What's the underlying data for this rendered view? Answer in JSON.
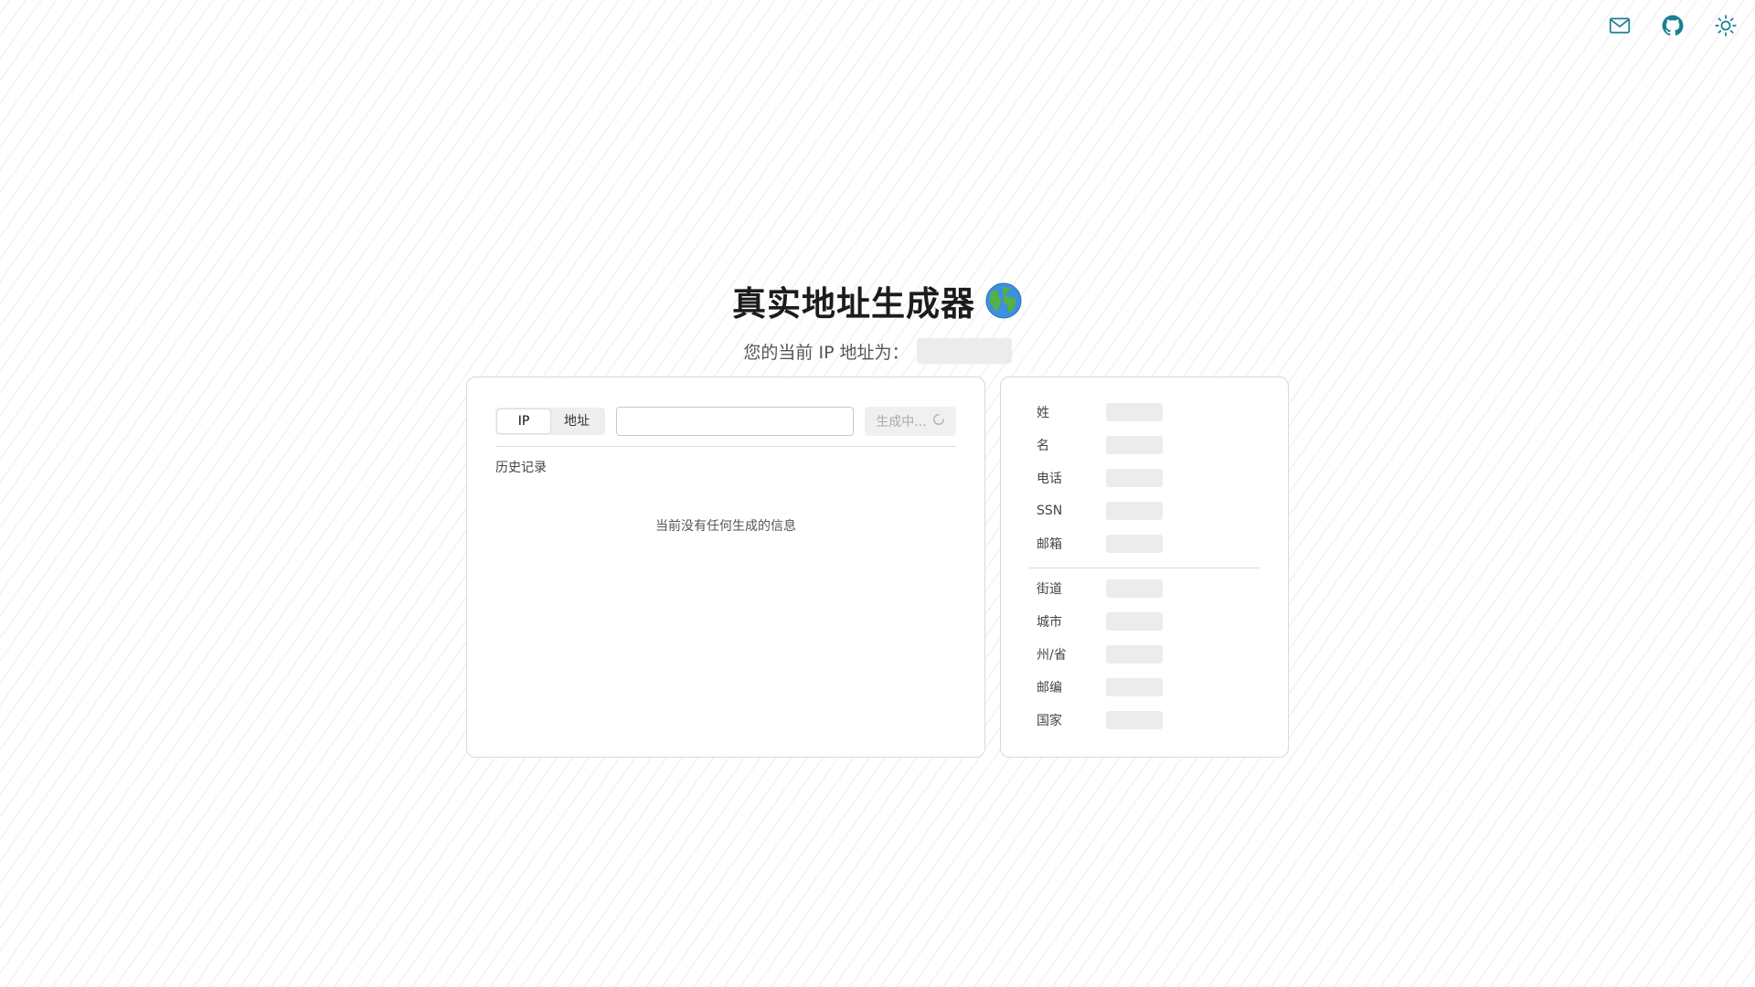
{
  "header": {
    "icons": [
      "mail-icon",
      "github-icon",
      "sun-icon"
    ],
    "accent_color": "#1b7f92"
  },
  "hero": {
    "title": "真实地址生成器",
    "title_emoji": "globe-icon",
    "subtitle": "您的当前 IP 地址为："
  },
  "generator": {
    "tabs": [
      {
        "label": "IP",
        "active": true
      },
      {
        "label": "地址",
        "active": false
      }
    ],
    "input_value": "",
    "input_placeholder": "",
    "generate_button": "生成中..."
  },
  "history": {
    "label": "历史记录",
    "empty_message": "当前没有任何生成的信息"
  },
  "details": {
    "personal": [
      {
        "label": "姓"
      },
      {
        "label": "名"
      },
      {
        "label": "电话"
      },
      {
        "label": "SSN"
      },
      {
        "label": "邮箱"
      }
    ],
    "address": [
      {
        "label": "街道"
      },
      {
        "label": "城市"
      },
      {
        "label": "州/省"
      },
      {
        "label": "邮编"
      },
      {
        "label": "国家"
      }
    ]
  }
}
